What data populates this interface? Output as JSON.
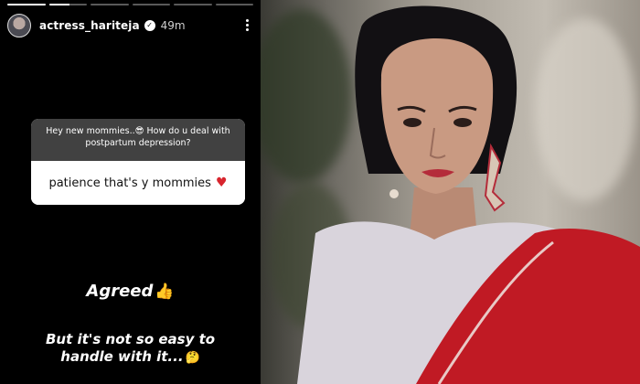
{
  "story": {
    "progress": [
      1,
      0.55,
      0,
      0,
      0,
      0
    ],
    "username": "actress_hariteja",
    "time": "49m",
    "question": "Hey new mommies..😎 How do u deal with postpartum depression?",
    "answer": "patience that's y mommies",
    "agreed": "Agreed",
    "line1": "But it's not so easy to",
    "line2": "handle with it..."
  },
  "icons": {
    "verified": "verified-badge-icon",
    "more": "more-vertical-icon",
    "heart": "heart-icon",
    "thumb": "thumbs-up-icon",
    "thinking": "thinking-face-icon"
  },
  "colors": {
    "story_bg": "#000000",
    "question_bg": "#414141",
    "heart": "#d8252e",
    "saree_red": "#c01a24"
  }
}
